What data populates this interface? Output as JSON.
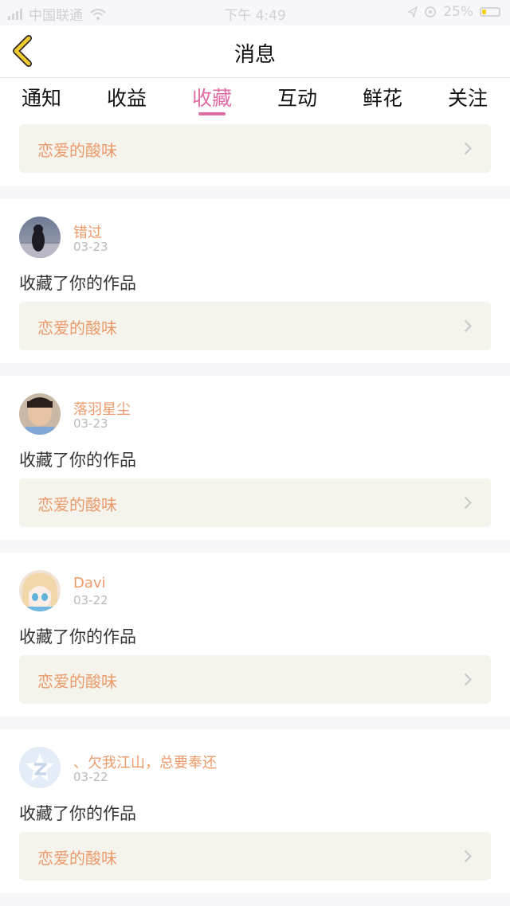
{
  "status_bar": {
    "carrier": "中国联通",
    "time": "下午 4:49",
    "battery": "25%",
    "battery_level": 0.25
  },
  "nav": {
    "title": "消息"
  },
  "tabs": [
    {
      "label": "通知"
    },
    {
      "label": "收益"
    },
    {
      "label": "收藏",
      "active": true
    },
    {
      "label": "互动"
    },
    {
      "label": "鲜花"
    },
    {
      "label": "关注"
    }
  ],
  "top_partial": {
    "work_title": "恋爱的酸味"
  },
  "items": [
    {
      "name": "错过",
      "date": "03-23",
      "action": "收藏了你的作品",
      "work_title": "恋爱的酸味"
    },
    {
      "name": "落羽星尘",
      "date": "03-23",
      "action": "收藏了你的作品",
      "work_title": "恋爱的酸味"
    },
    {
      "name": "Davi",
      "date": "03-22",
      "action": "收藏了你的作品",
      "work_title": "恋爱的酸味"
    },
    {
      "name": "、欠我江山，总要奉还",
      "date": "03-22",
      "action": "收藏了你的作品",
      "work_title": "恋爱的酸味"
    }
  ],
  "colors": {
    "accent": "#e06ca4",
    "name": "#ef9a6a",
    "work_box": "#f4f4ec",
    "back_arrow": "#f3cd2e"
  }
}
